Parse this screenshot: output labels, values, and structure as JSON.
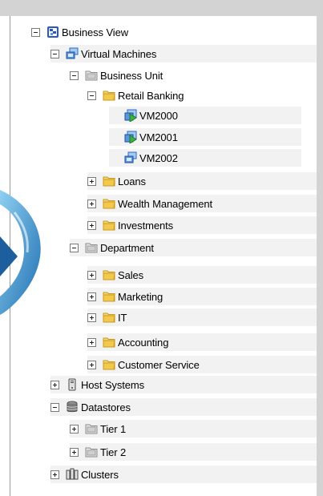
{
  "tree": {
    "nodes": [
      {
        "label": "Business View",
        "state": "expanded",
        "icon": "business-view-icon"
      },
      {
        "label": "Virtual Machines",
        "state": "expanded",
        "icon": "virtual-machines-icon"
      },
      {
        "label": "Business Unit",
        "state": "expanded",
        "icon": "gray-folder-icon"
      },
      {
        "label": "Retail Banking",
        "state": "expanded",
        "icon": "yellow-folder-icon"
      },
      {
        "label": "VM2000",
        "state": "leaf",
        "icon": "vm-powered-on-icon"
      },
      {
        "label": "VM2001",
        "state": "leaf",
        "icon": "vm-powered-on-icon"
      },
      {
        "label": "VM2002",
        "state": "leaf",
        "icon": "vm-icon"
      },
      {
        "label": "Loans",
        "state": "collapsed",
        "icon": "yellow-folder-icon"
      },
      {
        "label": "Wealth Management",
        "state": "collapsed",
        "icon": "yellow-folder-icon"
      },
      {
        "label": "Investments",
        "state": "collapsed",
        "icon": "yellow-folder-icon"
      },
      {
        "label": "Department",
        "state": "expanded",
        "icon": "gray-folder-icon"
      },
      {
        "label": "Sales",
        "state": "collapsed",
        "icon": "yellow-folder-icon"
      },
      {
        "label": "Marketing",
        "state": "collapsed",
        "icon": "yellow-folder-icon"
      },
      {
        "label": "IT",
        "state": "collapsed",
        "icon": "yellow-folder-icon"
      },
      {
        "label": "Accounting",
        "state": "collapsed",
        "icon": "yellow-folder-icon"
      },
      {
        "label": "Customer Service",
        "state": "collapsed",
        "icon": "yellow-folder-icon"
      },
      {
        "label": "Host Systems",
        "state": "collapsed",
        "icon": "host-system-icon"
      },
      {
        "label": "Datastores",
        "state": "expanded",
        "icon": "datastore-icon"
      },
      {
        "label": "Tier 1",
        "state": "collapsed",
        "icon": "gray-folder-icon"
      },
      {
        "label": "Tier 2",
        "state": "collapsed",
        "icon": "gray-folder-icon"
      },
      {
        "label": "Clusters",
        "state": "collapsed",
        "icon": "cluster-icon"
      }
    ]
  },
  "colors": {
    "frame": "#d3d3d3",
    "folder_yellow": "#f2c94c",
    "folder_gray": "#c8c8c8",
    "vm_blue": "#3b7dd8",
    "vm_green": "#3cb043",
    "accent_swirl": "#1f8fd0"
  }
}
